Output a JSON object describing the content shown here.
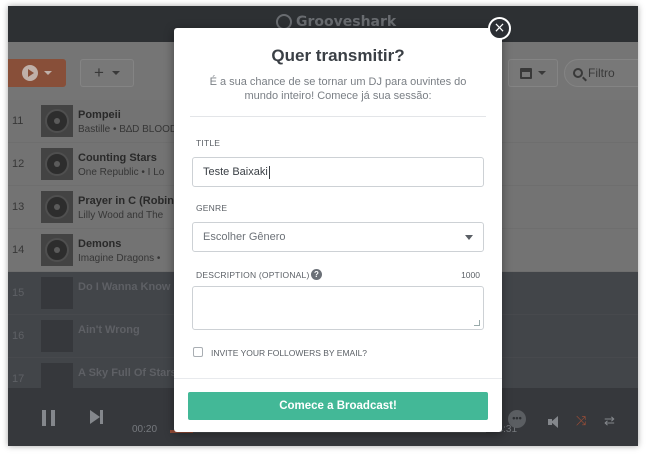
{
  "app": {
    "brand": "Grooveshark"
  },
  "toolbar": {
    "add_symbol": "+",
    "filter_placeholder": "Filtro"
  },
  "tracks": [
    {
      "number": "11",
      "title": "Pompeii",
      "artist": "Bastille • B∆D BLOOD",
      "dim": false
    },
    {
      "number": "12",
      "title": "Counting Stars",
      "artist": "One Republic • I Lo",
      "dim": false
    },
    {
      "number": "13",
      "title": "Prayer in C (Robin",
      "artist": "Lilly Wood and The",
      "dim": false
    },
    {
      "number": "14",
      "title": "Demons",
      "artist": "Imagine Dragons •",
      "dim": false
    },
    {
      "number": "15",
      "title": "Do I Wanna Know",
      "artist": "",
      "dim": true
    },
    {
      "number": "16",
      "title": "Ain't Wrong",
      "artist": "",
      "dim": true
    },
    {
      "number": "17",
      "title": "A Sky Full Of Stars",
      "artist": "",
      "dim": true
    }
  ],
  "player": {
    "elapsed": "00:20",
    "total": "04:31",
    "progress": 0.074
  },
  "modal": {
    "title": "Quer transmitir?",
    "description": "É a sua chance de se tornar um DJ para ouvintes do mundo inteiro! Comece já sua sessão:",
    "title_label": "TITLE",
    "title_value": "Teste Baixaki",
    "genre_label": "GENRE",
    "genre_value": "Escolher Gênero",
    "description_label": "DESCRIPTION (OPTIONAL)",
    "help_symbol": "?",
    "char_limit": "1000",
    "invite_label": "INVITE YOUR FOLLOWERS BY EMAIL?",
    "invite_checked": false,
    "submit_label": "Comece a Broadcast!",
    "close_symbol": "×"
  },
  "colors": {
    "accent_green": "#43b897",
    "accent_orange": "#c2593a",
    "header_dark": "#2f3237"
  }
}
